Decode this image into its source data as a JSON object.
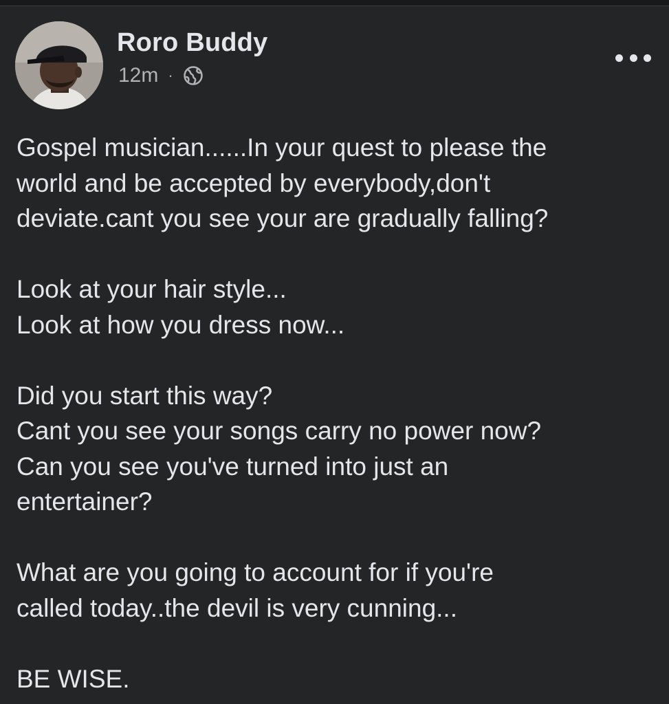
{
  "post": {
    "author": "Roro Buddy",
    "time": "12m",
    "separator": "·",
    "privacy_icon": "globe-icon",
    "more_icon": "more-horizontal-icon",
    "paragraphs": [
      "Gospel musician......In your quest to please the\nworld and be accepted by everybody,don't\ndeviate.cant you see your are gradually falling?",
      "Look at your hair style...\nLook at how you dress now...",
      "Did you start this way?\nCant you see your songs carry no power now?\nCan you see you've turned into just an\nentertainer?",
      "What are you going to account for if you're\ncalled today..the devil is very cunning...",
      "BE WISE."
    ]
  },
  "colors": {
    "background": "#242526",
    "primary_text": "#e4e6eb",
    "secondary_text": "#b0b3b8"
  }
}
